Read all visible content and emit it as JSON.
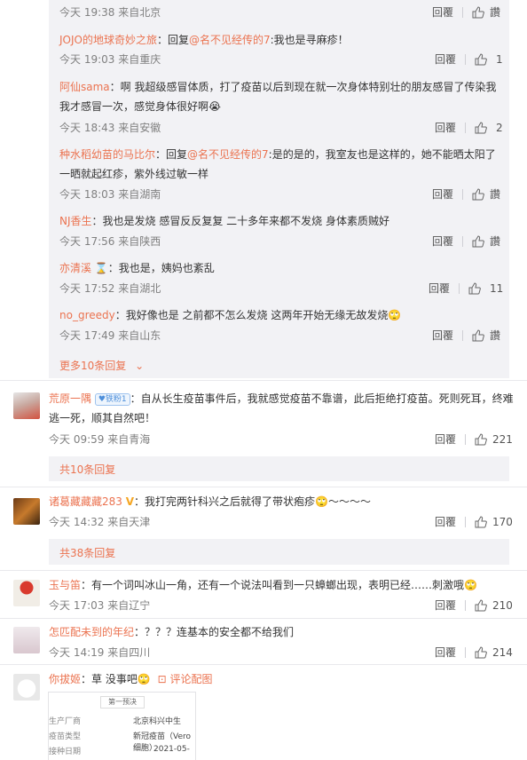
{
  "top_replies": [
    {
      "user": "",
      "text": "",
      "meta": "今天 19:38 来自北京",
      "action": "回覆",
      "count": "讚"
    },
    {
      "user": "JOJO的地球奇妙之旅",
      "prefix": "：回复",
      "mention": "@名不见经传的7",
      "text": ":我也是寻麻疹！",
      "meta": "今天 19:03 来自重庆",
      "action": "回覆",
      "count": "1"
    },
    {
      "user": "阿仙sama",
      "line1": "：啊 我超级感冒体质，打了疫苗以后到现在就一次身体特别壮的朋友感冒了传染我",
      "line2": "我才感冒一次，感觉身体很好啊😭",
      "meta": "今天 18:43 来自安徽",
      "action": "回覆",
      "count": "2"
    },
    {
      "user": "种水稻幼苗的马比尔",
      "prefix": "：回复",
      "mention": "@名不见经传的7",
      "line1": ":是的是的，我室友也是这样的，她不能晒太阳了",
      "line2": "一晒就起红疹，紫外线过敏一样",
      "meta": "今天 18:03 来自湖南",
      "action": "回覆",
      "count": "讚"
    },
    {
      "user": "NJ香生",
      "text": "：我也是发烧 感冒反反复复 二十多年来都不发烧 身体素质贼好",
      "meta": "今天 17:56 来自陕西",
      "action": "回覆",
      "count": "讚"
    },
    {
      "user": "亦清溪",
      "text": "：我也是，姨妈也紊乱",
      "meta": "今天 17:52 来自湖北",
      "action": "回覆",
      "count": "11"
    },
    {
      "user": "no_greedy",
      "text": "：我好像也是 之前都不怎么发烧 这两年开始无缘无故发烧🙄",
      "meta": "今天 17:49 来自山东",
      "action": "回覆",
      "count": "讚"
    }
  ],
  "more_replies": "更多10条回复",
  "comments": [
    {
      "user": "荒原一隅",
      "badge": "铁粉1",
      "line1": "：自从长生疫苗事件后，我就感觉疫苗不靠谱，此后拒绝打疫苗。死则死耳，终难",
      "line2": "逃一死，顺其自然吧！",
      "meta": "今天 09:59 来自青海",
      "action": "回覆",
      "count": "221",
      "sub": "共10条回复"
    },
    {
      "user": "诸葛藏藏藏283",
      "text": "：我打完两针科兴之后就得了带状疱疹🙄～～～～",
      "meta": "今天 14:32 来自天津",
      "action": "回覆",
      "count": "170",
      "sub": "共38条回复"
    },
    {
      "user": "玉与笛",
      "text": "：有一个词叫冰山一角，还有一个说法叫看到一只蟑螂出现，表明已经……刺激哦🙄",
      "meta": "今天 17:03 来自辽宁",
      "action": "回覆",
      "count": "210"
    },
    {
      "user": "怎匹配未到的年纪",
      "text": "：？？？连基本的安全都不给我们",
      "meta": "今天 14:19 来自四川",
      "action": "回覆",
      "count": "214"
    },
    {
      "user": "你拔姬",
      "text": "：草 没事吧🙄",
      "extra": "评论配图"
    }
  ],
  "image_doc": {
    "tab": "第一预决",
    "rows": [
      [
        "生产厂商",
        "北京科兴中生"
      ],
      [
        "疫苗类型",
        "新冠疫苗（Vero细胞）"
      ],
      [
        "接种日期",
        "2021-05-"
      ]
    ]
  }
}
